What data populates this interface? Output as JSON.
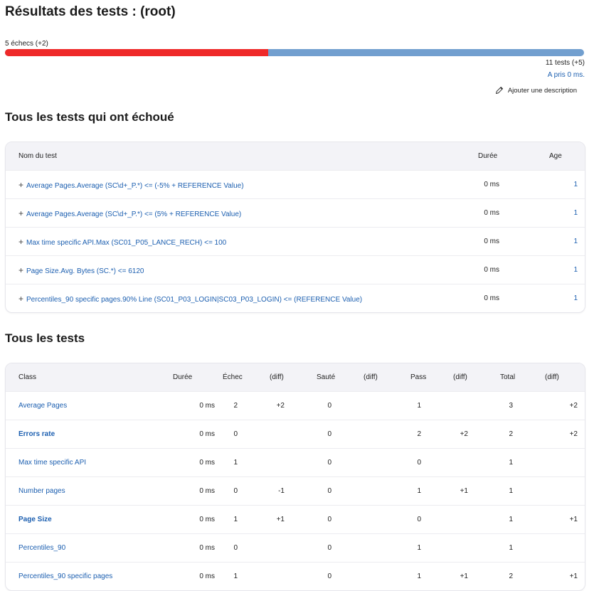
{
  "title": "Résultats des tests : (root)",
  "summary": {
    "failures": "5 échecs (+2)",
    "fail_fraction": 0.4545,
    "total": "11 tests (+5)",
    "duration": "A pris 0 ms.",
    "add_description": "Ajouter une description"
  },
  "colors": {
    "fail": "#ef2929",
    "pass": "#729fcf",
    "link": "#1c5fb0"
  },
  "failed_section": {
    "title": "Tous les tests qui ont échoué",
    "headers": {
      "name": "Nom du test",
      "duration": "Durée",
      "age": "Age"
    },
    "rows": [
      {
        "expand": "+",
        "name": "Average Pages.Average (SC\\d+_P.*) <= (-5% + REFERENCE Value)",
        "duration": "0 ms",
        "age": "1"
      },
      {
        "expand": "+",
        "name": "Average Pages.Average (SC\\d+_P.*) <= (5% + REFERENCE Value)",
        "duration": "0 ms",
        "age": "1"
      },
      {
        "expand": "+",
        "name": "Max time specific API.Max (SC01_P05_LANCE_RECH) <= 100",
        "duration": "0 ms",
        "age": "1"
      },
      {
        "expand": "+",
        "name": "Page Size.Avg. Bytes (SC.*) <= 6120",
        "duration": "0 ms",
        "age": "1"
      },
      {
        "expand": "+",
        "name": "Percentiles_90 specific pages.90% Line (SC01_P03_LOGIN|SC03_P03_LOGIN) <= (REFERENCE Value)",
        "duration": "0 ms",
        "age": "1"
      }
    ]
  },
  "all_section": {
    "title": "Tous les tests",
    "headers": {
      "class": "Class",
      "duration": "Durée",
      "fail": "Échec",
      "fail_diff": "(diff)",
      "skip": "Sauté",
      "skip_diff": "(diff)",
      "pass": "Pass",
      "pass_diff": "(diff)",
      "total": "Total",
      "total_diff": "(diff)"
    },
    "rows": [
      {
        "name": "Average Pages",
        "bold": false,
        "duration": "0 ms",
        "fail": "2",
        "fail_diff": "+2",
        "skip": "0",
        "skip_diff": "",
        "pass": "1",
        "pass_diff": "",
        "total": "3",
        "total_diff": "+2"
      },
      {
        "name": "Errors rate",
        "bold": true,
        "duration": "0 ms",
        "fail": "0",
        "fail_diff": "",
        "skip": "0",
        "skip_diff": "",
        "pass": "2",
        "pass_diff": "+2",
        "total": "2",
        "total_diff": "+2"
      },
      {
        "name": "Max time specific API",
        "bold": false,
        "duration": "0 ms",
        "fail": "1",
        "fail_diff": "",
        "skip": "0",
        "skip_diff": "",
        "pass": "0",
        "pass_diff": "",
        "total": "1",
        "total_diff": ""
      },
      {
        "name": "Number pages",
        "bold": false,
        "duration": "0 ms",
        "fail": "0",
        "fail_diff": "-1",
        "skip": "0",
        "skip_diff": "",
        "pass": "1",
        "pass_diff": "+1",
        "total": "1",
        "total_diff": ""
      },
      {
        "name": "Page Size",
        "bold": true,
        "duration": "0 ms",
        "fail": "1",
        "fail_diff": "+1",
        "skip": "0",
        "skip_diff": "",
        "pass": "0",
        "pass_diff": "",
        "total": "1",
        "total_diff": "+1"
      },
      {
        "name": "Percentiles_90",
        "bold": false,
        "duration": "0 ms",
        "fail": "0",
        "fail_diff": "",
        "skip": "0",
        "skip_diff": "",
        "pass": "1",
        "pass_diff": "",
        "total": "1",
        "total_diff": ""
      },
      {
        "name": "Percentiles_90 specific pages",
        "bold": false,
        "duration": "0 ms",
        "fail": "1",
        "fail_diff": "",
        "skip": "0",
        "skip_diff": "",
        "pass": "1",
        "pass_diff": "+1",
        "total": "2",
        "total_diff": "+1"
      }
    ]
  }
}
